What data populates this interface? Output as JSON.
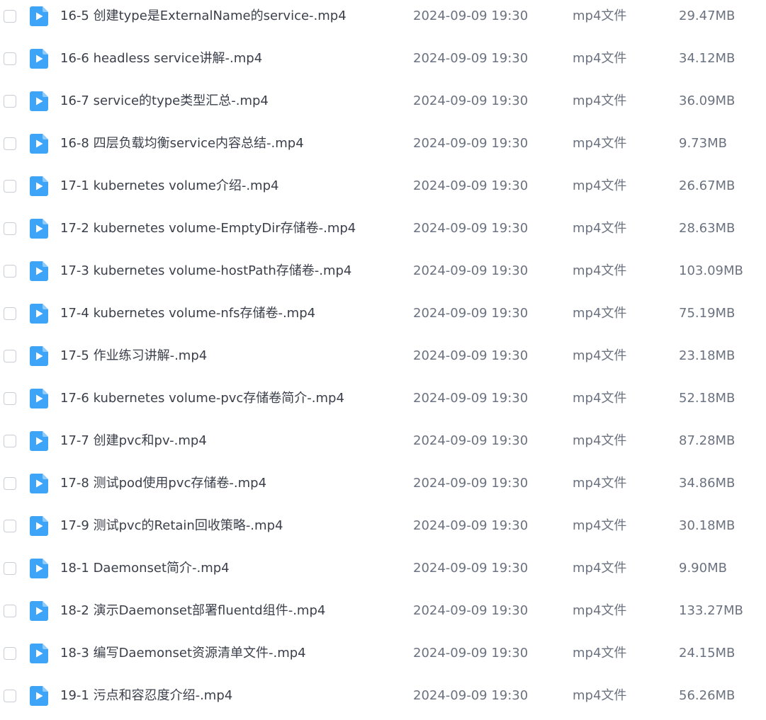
{
  "files": [
    {
      "name": "16-5 创建type是ExternalName的service-.mp4",
      "date": "2024-09-09 19:30",
      "type": "mp4文件",
      "size": "29.47MB",
      "icon": "video-file-icon"
    },
    {
      "name": "16-6 headless service讲解-.mp4",
      "date": "2024-09-09 19:30",
      "type": "mp4文件",
      "size": "34.12MB",
      "icon": "video-file-icon"
    },
    {
      "name": "16-7 service的type类型汇总-.mp4",
      "date": "2024-09-09 19:30",
      "type": "mp4文件",
      "size": "36.09MB",
      "icon": "video-file-icon"
    },
    {
      "name": "16-8 四层负载均衡service内容总结-.mp4",
      "date": "2024-09-09 19:30",
      "type": "mp4文件",
      "size": "9.73MB",
      "icon": "video-file-icon"
    },
    {
      "name": "17-1 kubernetes volume介绍-.mp4",
      "date": "2024-09-09 19:30",
      "type": "mp4文件",
      "size": "26.67MB",
      "icon": "video-file-icon"
    },
    {
      "name": "17-2 kubernetes volume-EmptyDir存储卷-.mp4",
      "date": "2024-09-09 19:30",
      "type": "mp4文件",
      "size": "28.63MB",
      "icon": "video-file-icon"
    },
    {
      "name": "17-3 kubernetes volume-hostPath存储卷-.mp4",
      "date": "2024-09-09 19:30",
      "type": "mp4文件",
      "size": "103.09MB",
      "icon": "video-file-icon"
    },
    {
      "name": "17-4 kubernetes volume-nfs存储卷-.mp4",
      "date": "2024-09-09 19:30",
      "type": "mp4文件",
      "size": "75.19MB",
      "icon": "video-file-icon"
    },
    {
      "name": "17-5 作业练习讲解-.mp4",
      "date": "2024-09-09 19:30",
      "type": "mp4文件",
      "size": "23.18MB",
      "icon": "video-file-icon"
    },
    {
      "name": "17-6 kubernetes volume-pvc存储卷简介-.mp4",
      "date": "2024-09-09 19:30",
      "type": "mp4文件",
      "size": "52.18MB",
      "icon": "video-file-icon"
    },
    {
      "name": "17-7 创建pvc和pv-.mp4",
      "date": "2024-09-09 19:30",
      "type": "mp4文件",
      "size": "87.28MB",
      "icon": "video-file-icon"
    },
    {
      "name": "17-8 测试pod使用pvc存储卷-.mp4",
      "date": "2024-09-09 19:30",
      "type": "mp4文件",
      "size": "34.86MB",
      "icon": "video-file-icon"
    },
    {
      "name": "17-9 测试pvc的Retain回收策略-.mp4",
      "date": "2024-09-09 19:30",
      "type": "mp4文件",
      "size": "30.18MB",
      "icon": "video-file-icon"
    },
    {
      "name": "18-1 Daemonset简介-.mp4",
      "date": "2024-09-09 19:30",
      "type": "mp4文件",
      "size": "9.90MB",
      "icon": "video-file-icon"
    },
    {
      "name": "18-2 演示Daemonset部署fluentd组件-.mp4",
      "date": "2024-09-09 19:30",
      "type": "mp4文件",
      "size": "133.27MB",
      "icon": "video-file-icon"
    },
    {
      "name": "18-3 编写Daemonset资源清单文件-.mp4",
      "date": "2024-09-09 19:30",
      "type": "mp4文件",
      "size": "24.15MB",
      "icon": "video-file-icon"
    },
    {
      "name": "19-1 污点和容忍度介绍-.mp4",
      "date": "2024-09-09 19:30",
      "type": "mp4文件",
      "size": "56.26MB",
      "icon": "video-file-icon"
    }
  ],
  "colors": {
    "icon_blue": "#3ea4f8",
    "icon_fold": "#8fcbfb",
    "text_primary": "#3a3f4a",
    "text_secondary": "#6b7280",
    "checkbox_border": "#c8cdd6"
  }
}
